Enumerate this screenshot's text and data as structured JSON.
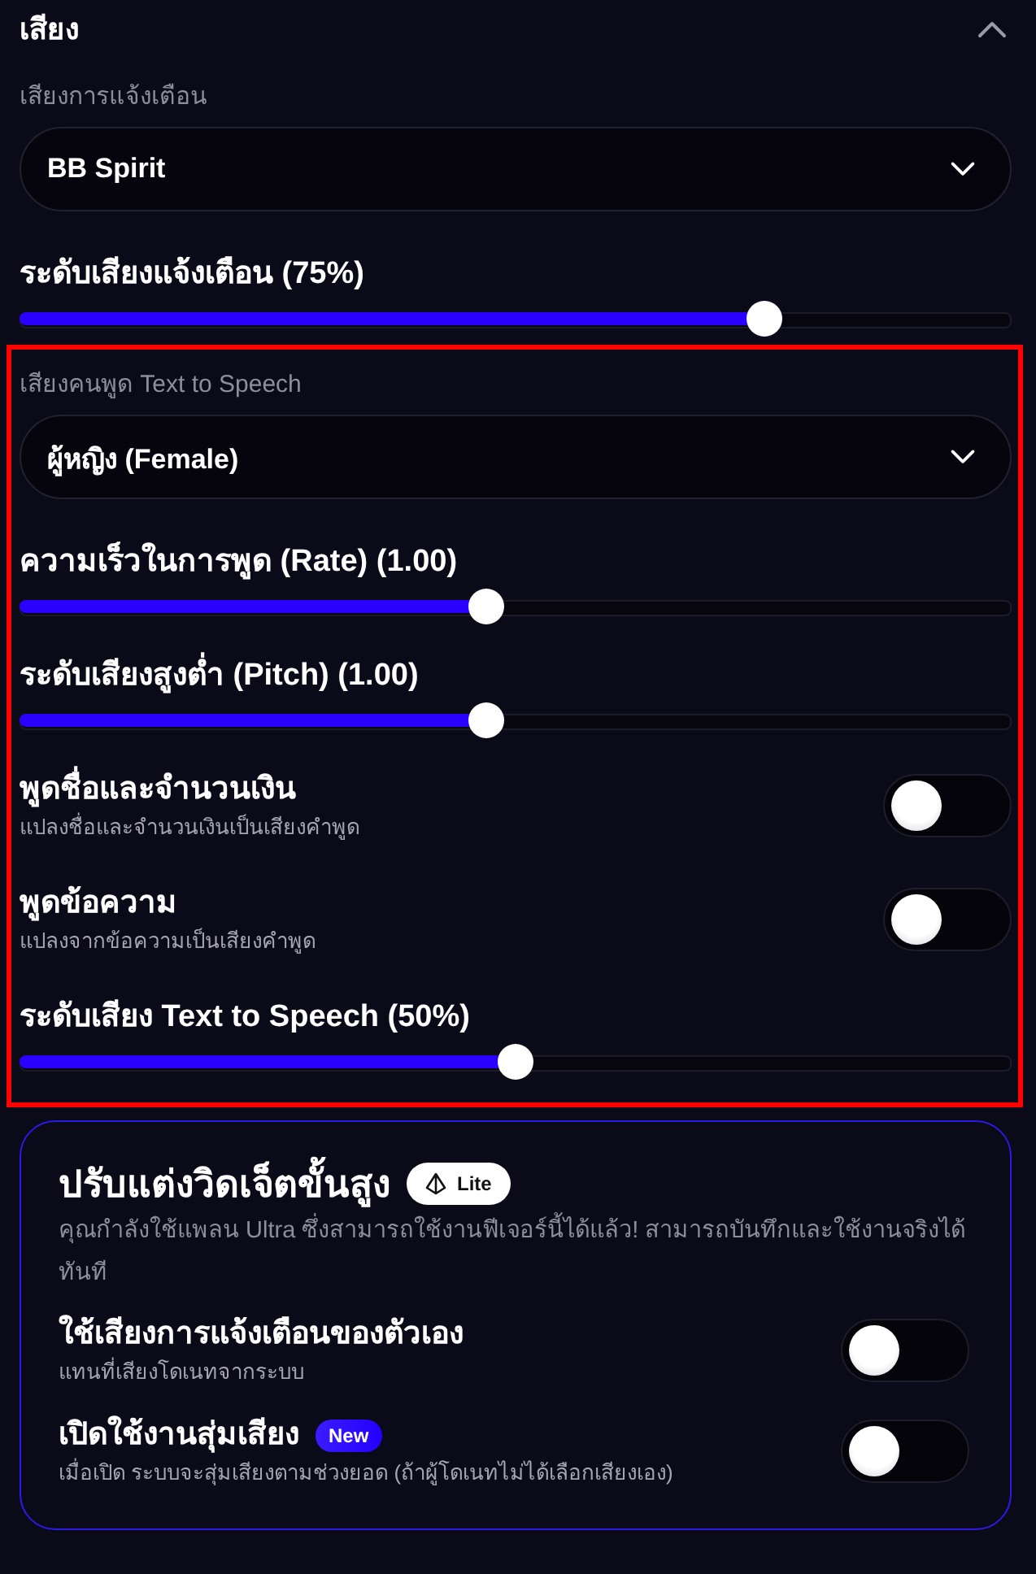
{
  "sound_section": {
    "title": "เสียง",
    "expanded": true,
    "items": [
      {
        "kind": "select",
        "label": "เสียงการแจ้งเตือน",
        "value": "BB Spirit"
      },
      {
        "kind": "slider",
        "label": "ระดับเสียงแจ้งเตือน (75%)",
        "level": 0.75
      }
    ]
  },
  "tts_section": {
    "highlighted": true,
    "items": [
      {
        "kind": "select",
        "label": "เสียงคนพูด Text to Speech",
        "value": "ผู้หญิง (Female)"
      },
      {
        "kind": "slider",
        "label": "ความเร็วในการพูด (Rate) (1.00)",
        "level": 0.47
      },
      {
        "kind": "slider",
        "label": "ระดับเสียงสูงต่ำ (Pitch) (1.00)",
        "level": 0.47
      },
      {
        "kind": "toggle",
        "label": "พูดชื่อและจำนวนเงิน",
        "description": "แปลงชื่อและจำนวนเงินเป็นเสียงคำพูด",
        "on": false
      },
      {
        "kind": "toggle",
        "label": "พูดข้อความ",
        "description": "แปลงจากข้อความเป็นเสียงคำพูด",
        "on": false
      },
      {
        "kind": "slider",
        "label": "ระดับเสียง Text to Speech (50%)",
        "level": 0.5
      }
    ]
  },
  "advanced_card": {
    "title": "ปรับแต่งวิดเจ็ตขั้นสูง",
    "badge": "Lite",
    "description": "คุณกำลังใช้แพลน Ultra ซึ่งสามารถใช้งานฟีเจอร์นี้ได้แล้ว! สามารถบันทึกและใช้งานจริงได้ทันที",
    "options": [
      {
        "kind": "toggle",
        "label": "ใช้เสียงการแจ้งเตือนของตัวเอง",
        "description": "แทนที่เสียงโดเนทจากระบบ",
        "on": false
      },
      {
        "kind": "toggle",
        "label": "เปิดใช้งานสุ่มเสียง",
        "badge": "New",
        "description": "เมื่อเปิด ระบบจะสุ่มเสียงตามช่วงยอด (ถ้าผู้โดเนทไม่ได้เลือกเสียงเอง)",
        "on": false
      }
    ]
  }
}
